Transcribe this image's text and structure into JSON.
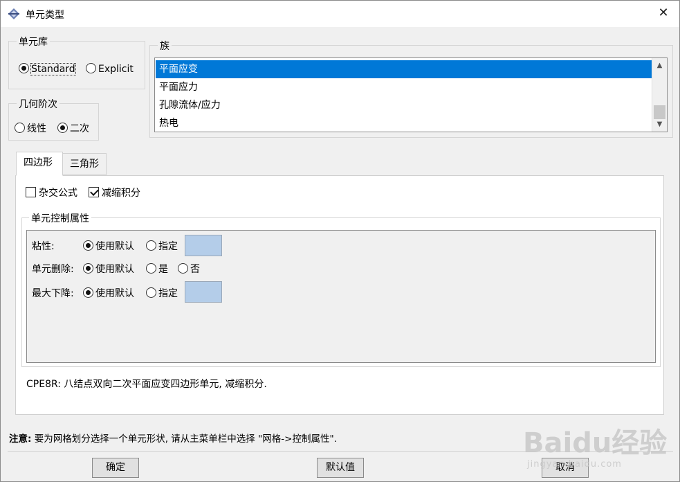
{
  "window": {
    "title": "单元类型"
  },
  "library": {
    "legend": "单元库",
    "options": [
      {
        "label": "Standard",
        "selected": true
      },
      {
        "label": "Explicit",
        "selected": false
      }
    ]
  },
  "geometric_order": {
    "legend": "几何阶次",
    "options": [
      {
        "label": "线性",
        "selected": false
      },
      {
        "label": "二次",
        "selected": true
      }
    ]
  },
  "family": {
    "legend": "族",
    "items": [
      {
        "label": "平面应变",
        "selected": true
      },
      {
        "label": "平面应力",
        "selected": false
      },
      {
        "label": "孔隙流体/应力",
        "selected": false
      },
      {
        "label": "热电",
        "selected": false
      }
    ]
  },
  "tabs": [
    {
      "label": "四边形",
      "active": true
    },
    {
      "label": "三角形",
      "active": false
    }
  ],
  "quad_tab": {
    "checkboxes": [
      {
        "label": "杂交公式",
        "checked": false
      },
      {
        "label": "减缩积分",
        "checked": true
      }
    ],
    "controls": {
      "legend": "单元控制属性",
      "rows": [
        {
          "label": "粘性:",
          "options": [
            "使用默认",
            "指定"
          ],
          "selected": 0
        },
        {
          "label": "单元删除:",
          "options": [
            "使用默认",
            "是",
            "否"
          ],
          "selected": 0
        },
        {
          "label": "最大下降:",
          "options": [
            "使用默认",
            "指定"
          ],
          "selected": 0
        }
      ]
    },
    "description": "CPE8R:  八结点双向二次平面应变四边形单元, 减缩积分."
  },
  "note": {
    "prefix": "注意:",
    "text": "要为网格划分选择一个单元形状, 请从主菜单栏中选择 \"网格->控制属性\"."
  },
  "buttons": {
    "ok": "确定",
    "defaults": "默认值",
    "cancel": "取消"
  },
  "watermark": {
    "main": "Baidu经验",
    "sub": "jingyan.baidu.com"
  }
}
